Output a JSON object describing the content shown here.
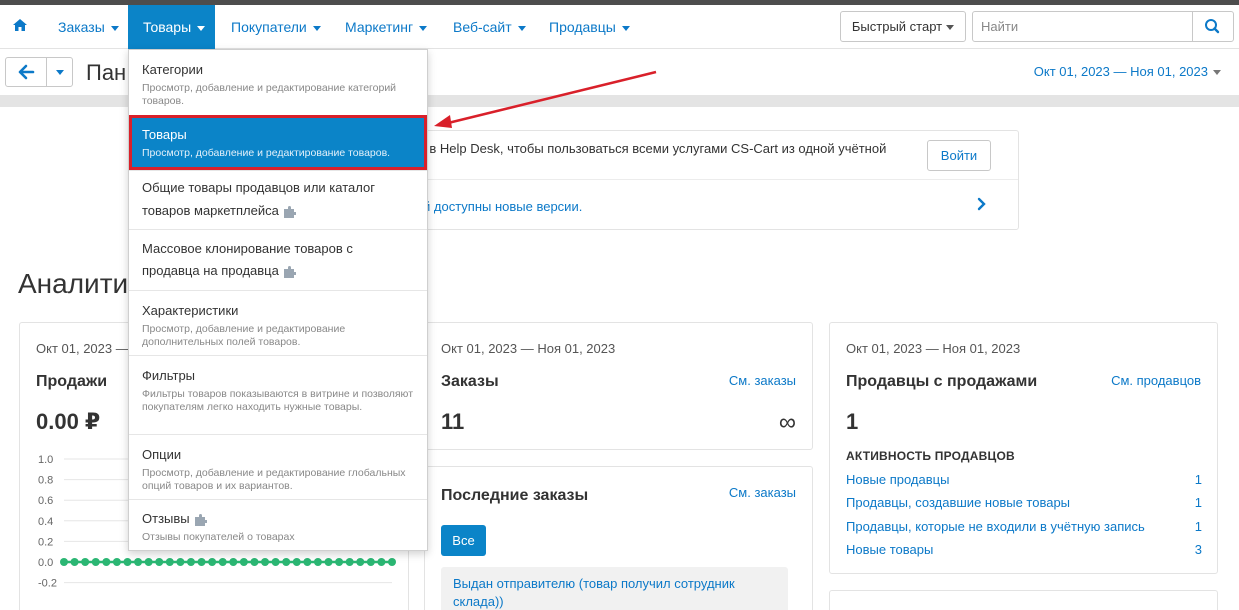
{
  "nav": {
    "items": [
      {
        "label": "Заказы"
      },
      {
        "label": "Товары"
      },
      {
        "label": "Покупатели"
      },
      {
        "label": "Маркетинг"
      },
      {
        "label": "Веб-сайт"
      },
      {
        "label": "Продавцы"
      }
    ],
    "quick_start": "Быстрый старт",
    "search_placeholder": "Найти"
  },
  "toolbar": {
    "page_title": "Пан",
    "date_range": "Окт 01, 2023 — Ноя 01, 2023"
  },
  "notice": {
    "text": "ь в Help Desk, чтобы пользоваться всеми услугами CS-Cart из одной учётной",
    "login_button": "Войти",
    "link": "й доступны новые версии."
  },
  "section_title": "Аналити",
  "sales": {
    "date": "Окт 01, 2023 —",
    "title": "Продажи",
    "value": "0.00 ₽"
  },
  "orders": {
    "date": "Окт 01, 2023 — Ноя 01, 2023",
    "title": "Заказы",
    "link": "См. заказы",
    "value": "11",
    "extra": "∞"
  },
  "recent_orders": {
    "title": "Последние заказы",
    "link": "См. заказы",
    "filter_all": "Все",
    "status_text": "Выдан отправителю (товар получил сотрудник склада))"
  },
  "vendors": {
    "date": "Окт 01, 2023 — Ноя 01, 2023",
    "title": "Продавцы с продажами",
    "link": "См. продавцов",
    "value": "1",
    "activity_title": "АКТИВНОСТЬ ПРОДАВЦОВ",
    "rows": [
      {
        "label": "Новые продавцы",
        "count": "1"
      },
      {
        "label": "Продавцы, создавшие новые товары",
        "count": "1"
      },
      {
        "label": "Продавцы, которые не входили в учётную запись",
        "count": "1"
      },
      {
        "label": "Новые товары",
        "count": "3"
      }
    ]
  },
  "dropdown": {
    "items": [
      {
        "title": "Категории",
        "desc": "Просмотр, добавление и редактирование категорий товаров."
      },
      {
        "title": "Товары",
        "desc": "Просмотр, добавление и редактирование товаров."
      },
      {
        "title": "Общие товары продавцов или каталог",
        "title2": "товаров маркетплейса"
      },
      {
        "title": "Массовое клонирование товаров с",
        "title2": "продавца на продавца"
      },
      {
        "title": "Характеристики",
        "desc": "Просмотр, добавление и редактирование дополнительных полей товаров."
      },
      {
        "title": "Фильтры",
        "desc": "Фильтры товаров показываются в витрине и позволяют покупателям легко находить нужные товары."
      },
      {
        "title": "Опции",
        "desc": "Просмотр, добавление и редактирование глобальных опций товаров и их вариантов."
      },
      {
        "title": "Отзывы",
        "desc": "Отзывы покупателей о товарах"
      }
    ]
  },
  "chart_data": {
    "type": "line",
    "yticks": [
      "1.0",
      "0.8",
      "0.6",
      "0.4",
      "0.2",
      "0.0",
      "-0.2"
    ],
    "ylim": [
      -0.2,
      1.0
    ],
    "series": [
      {
        "values": [
          0,
          0,
          0,
          0,
          0,
          0,
          0,
          0,
          0,
          0,
          0,
          0,
          0,
          0,
          0,
          0,
          0,
          0,
          0,
          0,
          0,
          0,
          0,
          0,
          0,
          0,
          0,
          0,
          0,
          0,
          0,
          0
        ],
        "color": "#2bb673"
      }
    ],
    "grid": true
  },
  "colors": {
    "accent": "#0b84c8",
    "link": "#0c79c8",
    "highlight_border": "#d9202a",
    "chart_series": "#2bb673"
  }
}
